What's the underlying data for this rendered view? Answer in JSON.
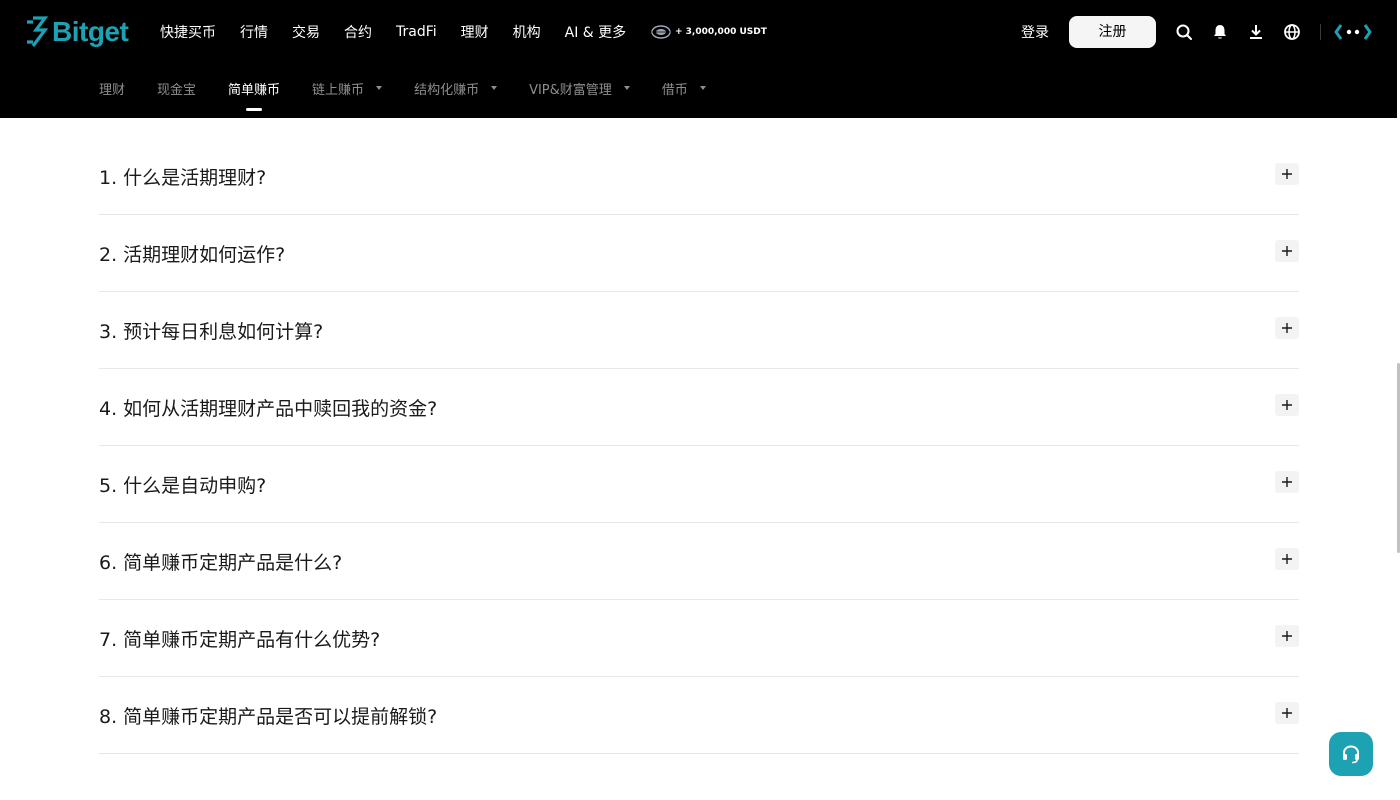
{
  "brand": {
    "name": "Bitget",
    "color": "#1da2b4"
  },
  "header": {
    "nav": [
      {
        "label": "快捷买币"
      },
      {
        "label": "行情"
      },
      {
        "label": "交易"
      },
      {
        "label": "合约"
      },
      {
        "label": "TradFi"
      },
      {
        "label": "理财"
      },
      {
        "label": "机构"
      },
      {
        "label": "AI & 更多"
      }
    ],
    "promo": {
      "text": "+ 3,000,000 USDT",
      "icon": "promo-badge-icon"
    },
    "login_label": "登录",
    "register_label": "注册",
    "icons": [
      "search-icon",
      "bell-icon",
      "download-icon",
      "globe-icon",
      "brand-mark-icon"
    ]
  },
  "sub_nav": {
    "items": [
      {
        "label": "理财",
        "active": false,
        "has_dropdown": false
      },
      {
        "label": "现金宝",
        "active": false,
        "has_dropdown": false
      },
      {
        "label": "简单赚币",
        "active": true,
        "has_dropdown": false
      },
      {
        "label": "链上赚币",
        "active": false,
        "has_dropdown": true
      },
      {
        "label": "结构化赚币",
        "active": false,
        "has_dropdown": true
      },
      {
        "label": "VIP&财富管理",
        "active": false,
        "has_dropdown": true
      },
      {
        "label": "借币",
        "active": false,
        "has_dropdown": true
      }
    ]
  },
  "faq": {
    "items": [
      {
        "question": "1. 什么是活期理财?"
      },
      {
        "question": "2. 活期理财如何运作?"
      },
      {
        "question": "3. 预计每日利息如何计算?"
      },
      {
        "question": "4. 如何从活期理财产品中赎回我的资金?"
      },
      {
        "question": "5. 什么是自动申购?"
      },
      {
        "question": "6. 简单赚币定期产品是什么?"
      },
      {
        "question": "7. 简单赚币定期产品有什么优势?"
      },
      {
        "question": "8. 简单赚币定期产品是否可以提前解锁?"
      }
    ],
    "toggle_icon": "plus-icon"
  },
  "support": {
    "icon": "headset-icon",
    "color": "#1da2b4"
  }
}
